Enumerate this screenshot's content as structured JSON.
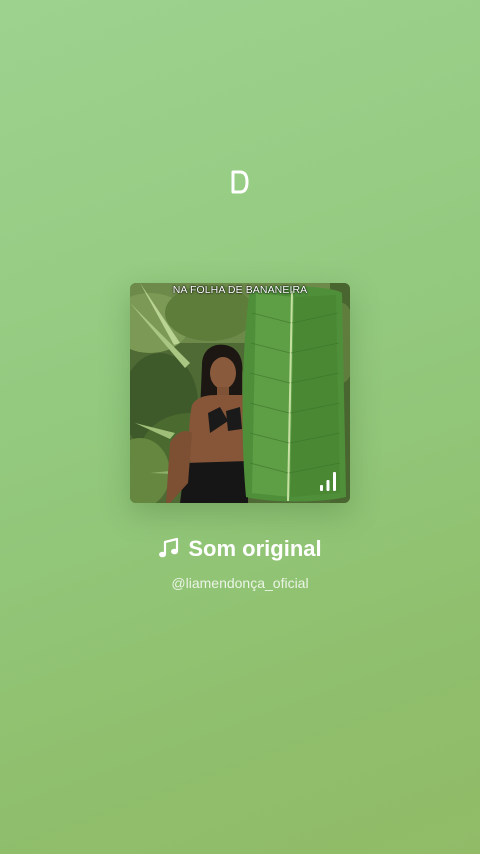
{
  "cover": {
    "caption": "NA FOLHA DE BANANEIRA",
    "audio_icon": "audio-bars-icon"
  },
  "sound": {
    "title": "Som original",
    "title_icon": "music-note-icon",
    "author": "@liamendonça_oficial"
  },
  "branding": {
    "logo_icon": "app-logo-icon"
  },
  "colors": {
    "background_top": "#9cd28e",
    "background_bottom": "#91bb67",
    "text": "#ffffff"
  }
}
